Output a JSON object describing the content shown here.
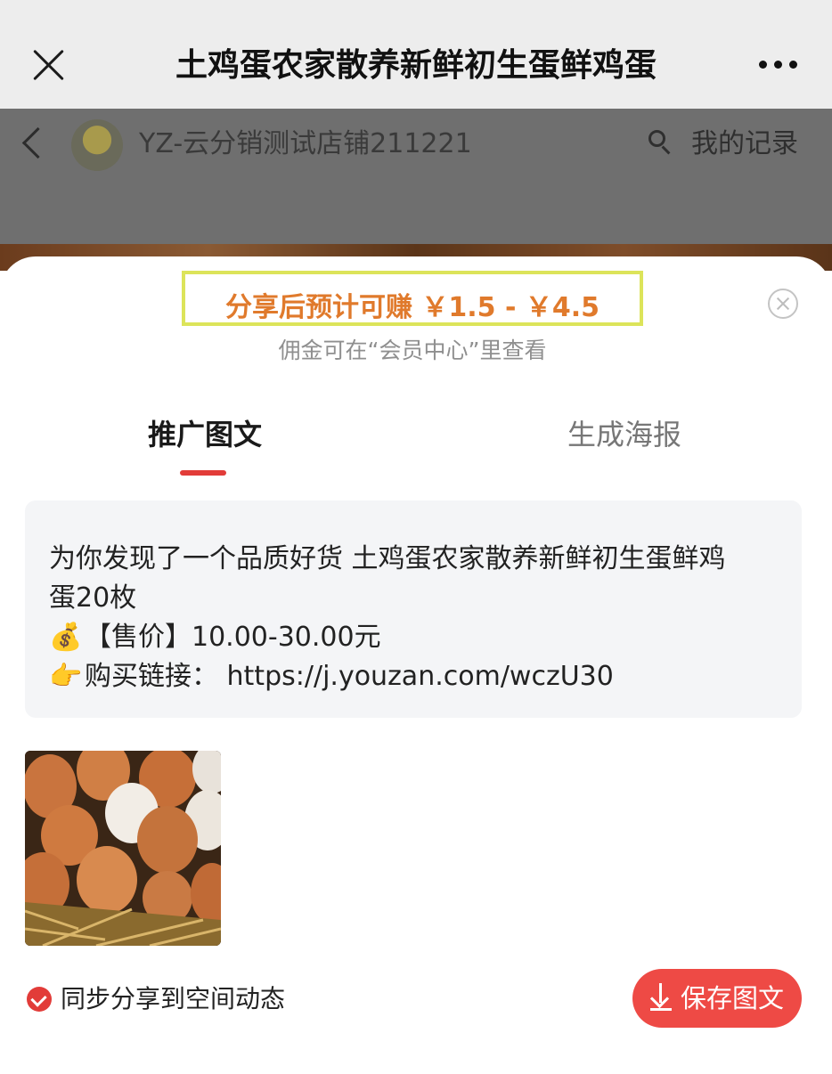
{
  "title_bar": {
    "title": "土鸡蛋农家散养新鲜初生蛋鲜鸡蛋"
  },
  "store_header": {
    "store_name": "YZ-云分销测试店铺211221",
    "my_records": "我的记录"
  },
  "share_sheet": {
    "earnings": "分享后预计可赚 ￥1.5 - ￥4.5",
    "commission_note": "佣金可在“会员中心”里查看",
    "tabs": [
      {
        "label": "推广图文",
        "active": true
      },
      {
        "label": "生成海报",
        "active": false
      }
    ],
    "promo_text": {
      "line1": "为你发现了一个品质好货 土鸡蛋农家散养新鲜初生蛋鲜鸡",
      "line2": "蛋20枚",
      "price_emoji": "💰",
      "price_line": "【售价】10.00-30.00元",
      "link_emoji": "👉",
      "link_line": "购买链接：  https://j.youzan.com/wczU30"
    },
    "sync_label": "同步分享到空间动态",
    "sync_checked": true,
    "save_button": "保存图文"
  },
  "colors": {
    "accent_red": "#e23c39",
    "earn_orange": "#e07a2c",
    "highlight_box": "#dce45a"
  }
}
